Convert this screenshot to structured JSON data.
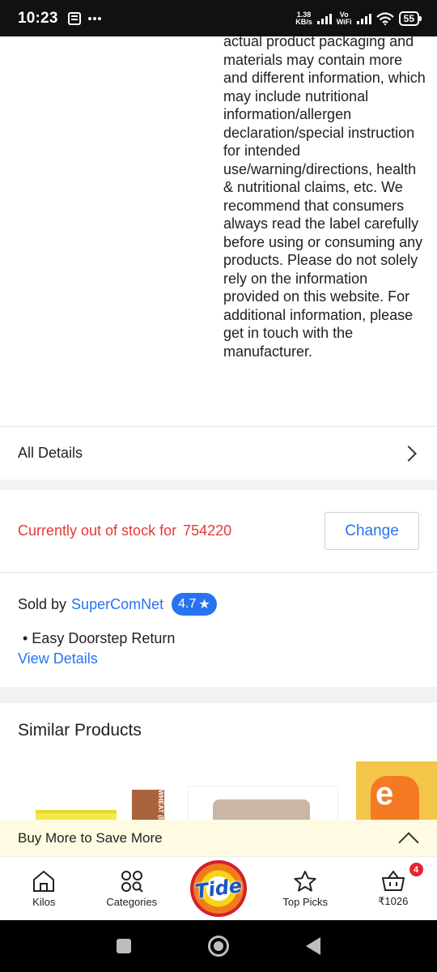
{
  "status_bar": {
    "time": "10:23",
    "net_speed_value": "1.38",
    "net_speed_unit": "KB/s",
    "vowifi_line1": "Vo",
    "vowifi_line2": "WiFi",
    "battery": "55"
  },
  "description": "actual product packaging and materials may contain more and different information, which may include nutritional information/allergen declaration/special instruction for intended use/warning/directions, health & nutritional claims, etc. We recommend that consumers always read the label carefully before using or consuming any products. Please do not solely rely on the information provided on this website. For additional information, please get in touch with the manufacturer.",
  "all_details": {
    "label": "All Details"
  },
  "stock": {
    "message": "Currently out of stock for",
    "pincode": "754220",
    "change_label": "Change",
    "color": "#e53935"
  },
  "seller": {
    "sold_by_label": "Sold by",
    "name": "SuperComNet",
    "rating": "4.7",
    "rating_star": "★",
    "feature": "• Easy Doorstep Return",
    "view_details": "View Details"
  },
  "similar_products": {
    "title": "Similar Products",
    "product_labels": [
      "WHEAT (BRAN)",
      "e"
    ]
  },
  "save_bar": {
    "text": "Buy More to Save More"
  },
  "bottom_nav": {
    "items": [
      {
        "label": "Kilos",
        "icon": "home-icon"
      },
      {
        "label": "Categories",
        "icon": "categories-icon"
      },
      {
        "label": "Tide",
        "icon": "tide-logo"
      },
      {
        "label": "Top Picks",
        "icon": "star-icon"
      },
      {
        "label": "₹1026",
        "icon": "basket-icon"
      }
    ],
    "cart_count": "4"
  },
  "colors": {
    "accent": "#2874f0",
    "error": "#e53935",
    "badge": "#e52630",
    "save_bar_bg": "#fffbe3"
  }
}
